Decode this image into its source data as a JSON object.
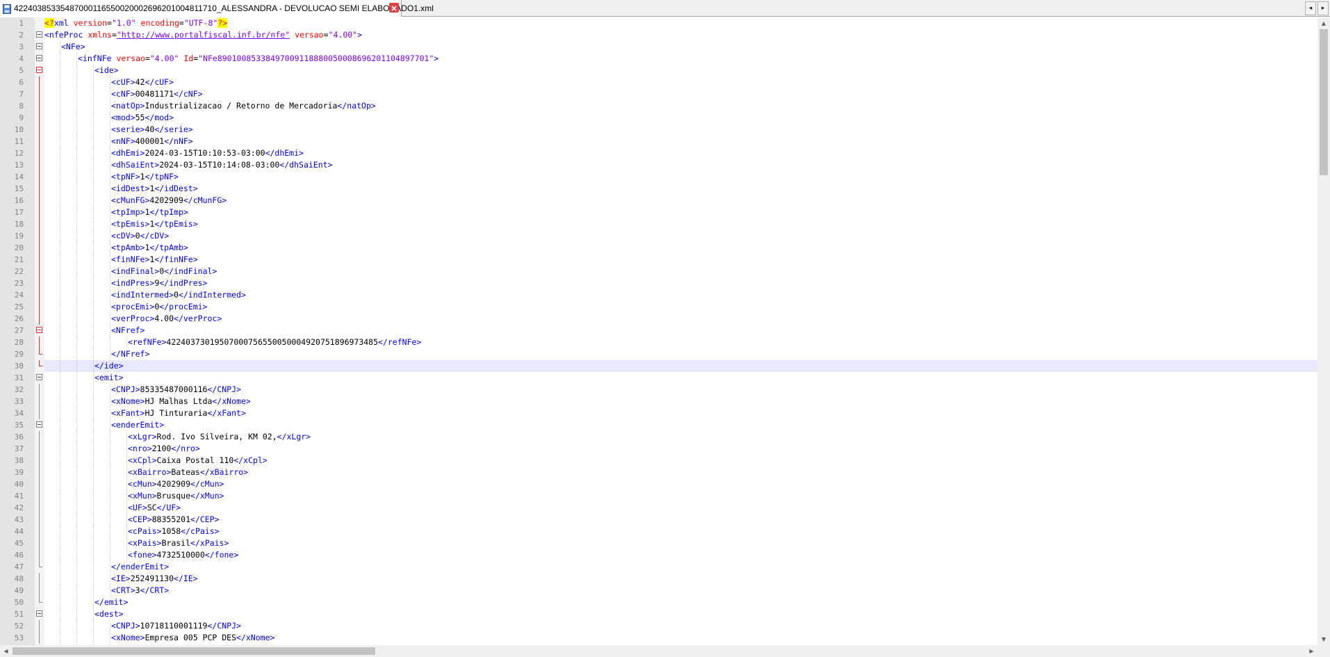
{
  "tab": {
    "title": "42240385335487000116550020002696201004811710_ALESSANDRA - DEVOLUCAO SEMI ELABORADO1.xml",
    "icon": "save-file-icon",
    "close_icon": "close-icon",
    "nav_left": "◂",
    "nav_right": "▸"
  },
  "colors": {
    "tag": "#0000ff",
    "attribute": "#ff0000",
    "value": "#8000ff",
    "text": "#000000",
    "current_line": "#e8e8ff",
    "fold_red": "#e03030"
  },
  "current_line": 30,
  "lines": [
    {
      "n": "1",
      "indent": 0,
      "fold": "none",
      "parts": [
        [
          "pi",
          "<?"
        ],
        [
          "tag",
          "xml "
        ],
        [
          "attr",
          "version"
        ],
        [
          "txt",
          "="
        ],
        [
          "val",
          "\"1.0\" "
        ],
        [
          "attr",
          "encoding"
        ],
        [
          "txt",
          "="
        ],
        [
          "val",
          "\"UTF-8\""
        ],
        [
          "pi",
          "?>"
        ]
      ]
    },
    {
      "n": "2",
      "indent": 0,
      "fold": "grey-box",
      "parts": [
        [
          "tag",
          "<nfeProc "
        ],
        [
          "attr",
          "xmlns"
        ],
        [
          "txt",
          "="
        ],
        [
          "url",
          "\"http://www.portalfiscal.inf.br/nfe\""
        ],
        [
          "tag",
          " "
        ],
        [
          "attr",
          "versao"
        ],
        [
          "txt",
          "="
        ],
        [
          "val",
          "\"4.00\""
        ],
        [
          "tag",
          ">"
        ]
      ]
    },
    {
      "n": "3",
      "indent": 1,
      "fold": "grey-box",
      "parts": [
        [
          "tag",
          "<NFe>"
        ]
      ]
    },
    {
      "n": "4",
      "indent": 2,
      "fold": "grey-box",
      "parts": [
        [
          "tag",
          "<infNFe "
        ],
        [
          "attr",
          "versao"
        ],
        [
          "txt",
          "="
        ],
        [
          "val",
          "\"4.00\" "
        ],
        [
          "attr",
          "Id"
        ],
        [
          "txt",
          "="
        ],
        [
          "val",
          "\"NFe89010085338497009118880050008696201104897701\""
        ],
        [
          "tag",
          ">"
        ]
      ]
    },
    {
      "n": "5",
      "indent": 3,
      "fold": "red-box",
      "parts": [
        [
          "tag",
          "<ide>"
        ]
      ]
    },
    {
      "n": "6",
      "indent": 4,
      "fold": "red-line",
      "parts": [
        [
          "tag",
          "<cUF>"
        ],
        [
          "txt",
          "42"
        ],
        [
          "tag",
          "</cUF>"
        ]
      ]
    },
    {
      "n": "7",
      "indent": 4,
      "fold": "red-line",
      "parts": [
        [
          "tag",
          "<cNF>"
        ],
        [
          "txt",
          "00481171"
        ],
        [
          "tag",
          "</cNF>"
        ]
      ]
    },
    {
      "n": "8",
      "indent": 4,
      "fold": "red-line",
      "parts": [
        [
          "tag",
          "<natOp>"
        ],
        [
          "txt",
          "Industrializacao / Retorno de Mercadoria"
        ],
        [
          "tag",
          "</natOp>"
        ]
      ]
    },
    {
      "n": "9",
      "indent": 4,
      "fold": "red-line",
      "parts": [
        [
          "tag",
          "<mod>"
        ],
        [
          "txt",
          "55"
        ],
        [
          "tag",
          "</mod>"
        ]
      ]
    },
    {
      "n": "10",
      "indent": 4,
      "fold": "red-line",
      "parts": [
        [
          "tag",
          "<serie>"
        ],
        [
          "txt",
          "40"
        ],
        [
          "tag",
          "</serie>"
        ]
      ]
    },
    {
      "n": "11",
      "indent": 4,
      "fold": "red-line",
      "parts": [
        [
          "tag",
          "<nNF>"
        ],
        [
          "txt",
          "400001"
        ],
        [
          "tag",
          "</nNF>"
        ]
      ]
    },
    {
      "n": "12",
      "indent": 4,
      "fold": "red-line",
      "parts": [
        [
          "tag",
          "<dhEmi>"
        ],
        [
          "txt",
          "2024-03-15T10:10:53-03:00"
        ],
        [
          "tag",
          "</dhEmi>"
        ]
      ]
    },
    {
      "n": "13",
      "indent": 4,
      "fold": "red-line",
      "parts": [
        [
          "tag",
          "<dhSaiEnt>"
        ],
        [
          "txt",
          "2024-03-15T10:14:08-03:00"
        ],
        [
          "tag",
          "</dhSaiEnt>"
        ]
      ]
    },
    {
      "n": "14",
      "indent": 4,
      "fold": "red-line",
      "parts": [
        [
          "tag",
          "<tpNF>"
        ],
        [
          "txt",
          "1"
        ],
        [
          "tag",
          "</tpNF>"
        ]
      ]
    },
    {
      "n": "15",
      "indent": 4,
      "fold": "red-line",
      "parts": [
        [
          "tag",
          "<idDest>"
        ],
        [
          "txt",
          "1"
        ],
        [
          "tag",
          "</idDest>"
        ]
      ]
    },
    {
      "n": "16",
      "indent": 4,
      "fold": "red-line",
      "parts": [
        [
          "tag",
          "<cMunFG>"
        ],
        [
          "txt",
          "4202909"
        ],
        [
          "tag",
          "</cMunFG>"
        ]
      ]
    },
    {
      "n": "17",
      "indent": 4,
      "fold": "red-line",
      "parts": [
        [
          "tag",
          "<tpImp>"
        ],
        [
          "txt",
          "1"
        ],
        [
          "tag",
          "</tpImp>"
        ]
      ]
    },
    {
      "n": "18",
      "indent": 4,
      "fold": "red-line",
      "parts": [
        [
          "tag",
          "<tpEmis>"
        ],
        [
          "txt",
          "1"
        ],
        [
          "tag",
          "</tpEmis>"
        ]
      ]
    },
    {
      "n": "19",
      "indent": 4,
      "fold": "red-line",
      "parts": [
        [
          "tag",
          "<cDV>"
        ],
        [
          "txt",
          "0"
        ],
        [
          "tag",
          "</cDV>"
        ]
      ]
    },
    {
      "n": "20",
      "indent": 4,
      "fold": "red-line",
      "parts": [
        [
          "tag",
          "<tpAmb>"
        ],
        [
          "txt",
          "1"
        ],
        [
          "tag",
          "</tpAmb>"
        ]
      ]
    },
    {
      "n": "21",
      "indent": 4,
      "fold": "red-line",
      "parts": [
        [
          "tag",
          "<finNFe>"
        ],
        [
          "txt",
          "1"
        ],
        [
          "tag",
          "</finNFe>"
        ]
      ]
    },
    {
      "n": "22",
      "indent": 4,
      "fold": "red-line",
      "parts": [
        [
          "tag",
          "<indFinal>"
        ],
        [
          "txt",
          "0"
        ],
        [
          "tag",
          "</indFinal>"
        ]
      ]
    },
    {
      "n": "23",
      "indent": 4,
      "fold": "red-line",
      "parts": [
        [
          "tag",
          "<indPres>"
        ],
        [
          "txt",
          "9"
        ],
        [
          "tag",
          "</indPres>"
        ]
      ]
    },
    {
      "n": "24",
      "indent": 4,
      "fold": "red-line",
      "parts": [
        [
          "tag",
          "<indIntermed>"
        ],
        [
          "txt",
          "0"
        ],
        [
          "tag",
          "</indIntermed>"
        ]
      ]
    },
    {
      "n": "25",
      "indent": 4,
      "fold": "red-line",
      "parts": [
        [
          "tag",
          "<procEmi>"
        ],
        [
          "txt",
          "0"
        ],
        [
          "tag",
          "</procEmi>"
        ]
      ]
    },
    {
      "n": "26",
      "indent": 4,
      "fold": "red-line",
      "parts": [
        [
          "tag",
          "<verProc>"
        ],
        [
          "txt",
          "4.00"
        ],
        [
          "tag",
          "</verProc>"
        ]
      ]
    },
    {
      "n": "27",
      "indent": 4,
      "fold": "red-box",
      "parts": [
        [
          "tag",
          "<NFref>"
        ]
      ]
    },
    {
      "n": "28",
      "indent": 5,
      "fold": "red-line",
      "parts": [
        [
          "tag",
          "<refNFe>"
        ],
        [
          "txt",
          "42240373019507000756550050004920751896973485"
        ],
        [
          "tag",
          "</refNFe>"
        ]
      ]
    },
    {
      "n": "29",
      "indent": 4,
      "fold": "red-end",
      "parts": [
        [
          "tag",
          "</NFref>"
        ]
      ]
    },
    {
      "n": "30",
      "indent": 3,
      "fold": "red-end",
      "parts": [
        [
          "tag",
          "</ide>"
        ]
      ]
    },
    {
      "n": "31",
      "indent": 3,
      "fold": "grey-box",
      "parts": [
        [
          "tag",
          "<emit>"
        ]
      ]
    },
    {
      "n": "32",
      "indent": 4,
      "fold": "grey-line",
      "parts": [
        [
          "tag",
          "<CNPJ>"
        ],
        [
          "txt",
          "85335487000116"
        ],
        [
          "tag",
          "</CNPJ>"
        ]
      ]
    },
    {
      "n": "33",
      "indent": 4,
      "fold": "grey-line",
      "parts": [
        [
          "tag",
          "<xNome>"
        ],
        [
          "txt",
          "HJ Malhas Ltda"
        ],
        [
          "tag",
          "</xNome>"
        ]
      ]
    },
    {
      "n": "34",
      "indent": 4,
      "fold": "grey-line",
      "parts": [
        [
          "tag",
          "<xFant>"
        ],
        [
          "txt",
          "HJ Tinturaria"
        ],
        [
          "tag",
          "</xFant>"
        ]
      ]
    },
    {
      "n": "35",
      "indent": 4,
      "fold": "grey-box",
      "parts": [
        [
          "tag",
          "<enderEmit>"
        ]
      ]
    },
    {
      "n": "36",
      "indent": 5,
      "fold": "grey-line",
      "parts": [
        [
          "tag",
          "<xLgr>"
        ],
        [
          "txt",
          "Rod. Ivo Silveira, KM 02,"
        ],
        [
          "tag",
          "</xLgr>"
        ]
      ]
    },
    {
      "n": "37",
      "indent": 5,
      "fold": "grey-line",
      "parts": [
        [
          "tag",
          "<nro>"
        ],
        [
          "txt",
          "2100"
        ],
        [
          "tag",
          "</nro>"
        ]
      ]
    },
    {
      "n": "38",
      "indent": 5,
      "fold": "grey-line",
      "parts": [
        [
          "tag",
          "<xCpl>"
        ],
        [
          "txt",
          "Caixa Postal 110"
        ],
        [
          "tag",
          "</xCpl>"
        ]
      ]
    },
    {
      "n": "39",
      "indent": 5,
      "fold": "grey-line",
      "parts": [
        [
          "tag",
          "<xBairro>"
        ],
        [
          "txt",
          "Bateas"
        ],
        [
          "tag",
          "</xBairro>"
        ]
      ]
    },
    {
      "n": "40",
      "indent": 5,
      "fold": "grey-line",
      "parts": [
        [
          "tag",
          "<cMun>"
        ],
        [
          "txt",
          "4202909"
        ],
        [
          "tag",
          "</cMun>"
        ]
      ]
    },
    {
      "n": "41",
      "indent": 5,
      "fold": "grey-line",
      "parts": [
        [
          "tag",
          "<xMun>"
        ],
        [
          "txt",
          "Brusque"
        ],
        [
          "tag",
          "</xMun>"
        ]
      ]
    },
    {
      "n": "42",
      "indent": 5,
      "fold": "grey-line",
      "parts": [
        [
          "tag",
          "<UF>"
        ],
        [
          "txt",
          "SC"
        ],
        [
          "tag",
          "</UF>"
        ]
      ]
    },
    {
      "n": "43",
      "indent": 5,
      "fold": "grey-line",
      "parts": [
        [
          "tag",
          "<CEP>"
        ],
        [
          "txt",
          "88355201"
        ],
        [
          "tag",
          "</CEP>"
        ]
      ]
    },
    {
      "n": "44",
      "indent": 5,
      "fold": "grey-line",
      "parts": [
        [
          "tag",
          "<cPais>"
        ],
        [
          "txt",
          "1058"
        ],
        [
          "tag",
          "</cPais>"
        ]
      ]
    },
    {
      "n": "45",
      "indent": 5,
      "fold": "grey-line",
      "parts": [
        [
          "tag",
          "<xPais>"
        ],
        [
          "txt",
          "Brasil"
        ],
        [
          "tag",
          "</xPais>"
        ]
      ]
    },
    {
      "n": "46",
      "indent": 5,
      "fold": "grey-line",
      "parts": [
        [
          "tag",
          "<fone>"
        ],
        [
          "txt",
          "4732510000"
        ],
        [
          "tag",
          "</fone>"
        ]
      ]
    },
    {
      "n": "47",
      "indent": 4,
      "fold": "grey-end",
      "parts": [
        [
          "tag",
          "</enderEmit>"
        ]
      ]
    },
    {
      "n": "48",
      "indent": 4,
      "fold": "grey-line",
      "parts": [
        [
          "tag",
          "<IE>"
        ],
        [
          "txt",
          "252491130"
        ],
        [
          "tag",
          "</IE>"
        ]
      ]
    },
    {
      "n": "49",
      "indent": 4,
      "fold": "grey-line",
      "parts": [
        [
          "tag",
          "<CRT>"
        ],
        [
          "txt",
          "3"
        ],
        [
          "tag",
          "</CRT>"
        ]
      ]
    },
    {
      "n": "50",
      "indent": 3,
      "fold": "grey-end",
      "parts": [
        [
          "tag",
          "</emit>"
        ]
      ]
    },
    {
      "n": "51",
      "indent": 3,
      "fold": "grey-box",
      "parts": [
        [
          "tag",
          "<dest>"
        ]
      ]
    },
    {
      "n": "52",
      "indent": 4,
      "fold": "grey-line",
      "parts": [
        [
          "tag",
          "<CNPJ>"
        ],
        [
          "txt",
          "10718110001119"
        ],
        [
          "tag",
          "</CNPJ>"
        ]
      ]
    },
    {
      "n": "53",
      "indent": 4,
      "fold": "grey-line",
      "parts": [
        [
          "tag",
          "<xNome>"
        ],
        [
          "txt",
          "Empresa 005 PCP DES"
        ],
        [
          "tag",
          "</xNome>"
        ]
      ]
    }
  ],
  "scroll": {
    "up_arrow": "▲",
    "down_arrow": "▼",
    "left_arrow": "◀",
    "right_arrow": "▶"
  }
}
